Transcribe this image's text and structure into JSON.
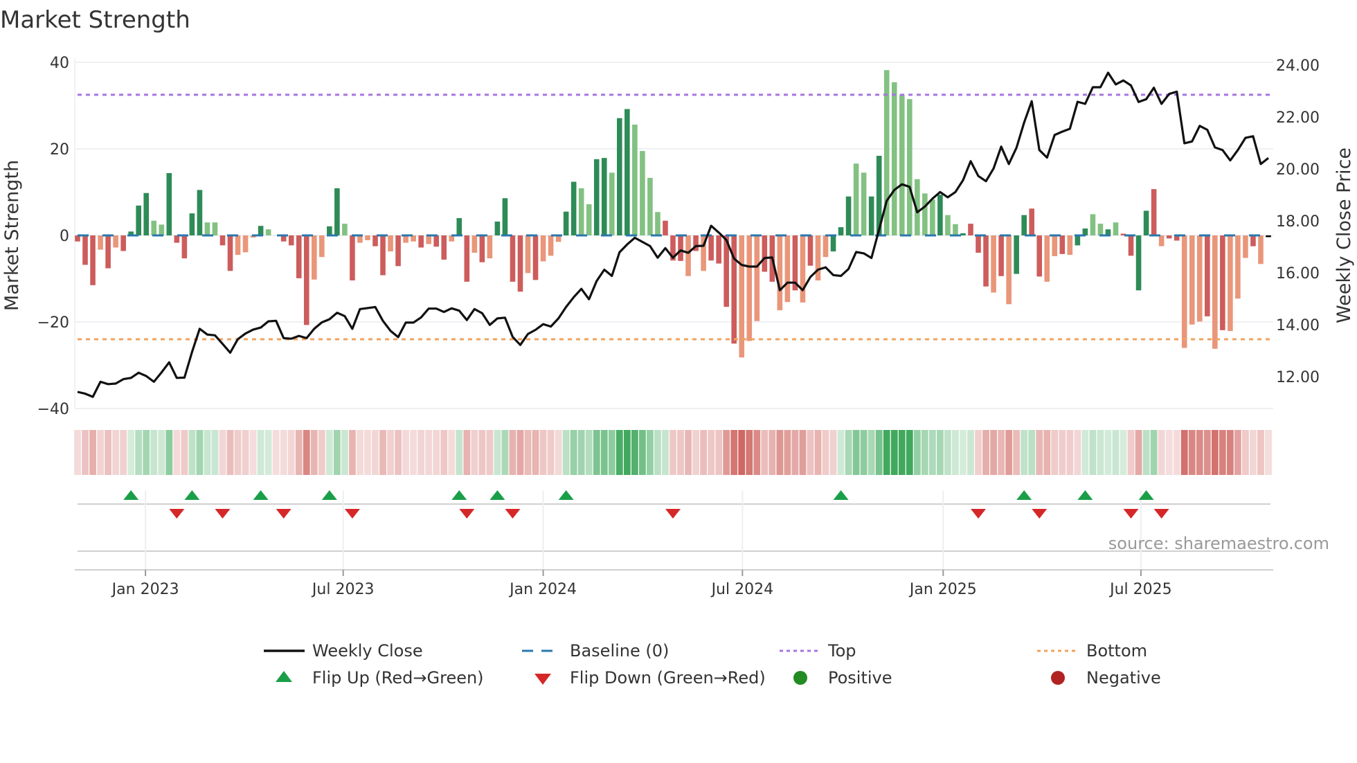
{
  "title": "Market Strength",
  "source": "source: sharemaestro.com",
  "colors": {
    "strong_positive": "#2e8b57",
    "weak_positive": "#82c182",
    "strong_negative": "#cd5c5c",
    "weak_negative": "#e9967a",
    "weekly_close": "#111111",
    "baseline": "#2a77ad",
    "top": "#a774e0",
    "bottom": "#f0a35e",
    "flip_up": "#1a9f48",
    "flip_down": "#d62728",
    "positive": "#228b22",
    "negative": "#b22222",
    "heat_green": "#2ca04c",
    "heat_red": "#c9544f"
  },
  "legend": [
    {
      "label": "Weekly Close",
      "icon": "solid-line"
    },
    {
      "label": "Baseline (0)",
      "icon": "dashed-line"
    },
    {
      "label": "Top",
      "icon": "dotted-line"
    },
    {
      "label": "Bottom",
      "icon": "dotted-line"
    },
    {
      "label": "Flip Up (Red→Green)",
      "icon": "triangle-up"
    },
    {
      "label": "Flip Down (Green→Red)",
      "icon": "triangle-down"
    },
    {
      "label": "Positive",
      "icon": "circle"
    },
    {
      "label": "Negative",
      "icon": "circle"
    }
  ],
  "chart_data": {
    "type": "bar",
    "title": "Market Strength",
    "ylabel": "Market Strength",
    "y2label": "Weekly Close Price",
    "ylim": [
      -40,
      40
    ],
    "y2lim": [
      10.77,
      24.11
    ],
    "grid": true,
    "legend_position": "bottom",
    "yticks": [
      {
        "v": 40,
        "label": "40"
      },
      {
        "v": 20,
        "label": "20"
      },
      {
        "v": 0,
        "label": "0"
      },
      {
        "v": -20,
        "label": "−20"
      },
      {
        "v": -40,
        "label": "−40"
      }
    ],
    "y2ticks": [
      {
        "v": 24,
        "label": "24.00"
      },
      {
        "v": 22,
        "label": "22.00"
      },
      {
        "v": 20,
        "label": "20.00"
      },
      {
        "v": 18,
        "label": "18.00"
      },
      {
        "v": 16,
        "label": "16.00"
      },
      {
        "v": 14,
        "label": "14.00"
      },
      {
        "v": 12,
        "label": "12.00"
      }
    ],
    "xticks": [
      {
        "week": 8.9,
        "label": "Jan 2023"
      },
      {
        "week": 34.8,
        "label": "Jul 2023"
      },
      {
        "week": 61,
        "label": "Jan 2024"
      },
      {
        "week": 87.1,
        "label": "Jul 2024"
      },
      {
        "week": 113.4,
        "label": "Jan 2025"
      },
      {
        "week": 139.3,
        "label": "Jul 2025"
      }
    ],
    "top_level": 32.5,
    "bottom_level": -24,
    "strength": [
      -1.4,
      -6.8,
      -11.5,
      -3.3,
      -7.6,
      -2.8,
      -3.6,
      0.9,
      6.9,
      9.8,
      3.4,
      2.5,
      14.4,
      -1.7,
      -5.3,
      5.1,
      10.5,
      3.0,
      3.0,
      -2.3,
      -8.2,
      -4.5,
      -3.9,
      -0.5,
      2.2,
      1.4,
      0,
      -1.4,
      -2.3,
      -9.9,
      -20.7,
      -10.2,
      -5,
      2.1,
      10.9,
      2.7,
      -10.4,
      -1.7,
      -1.1,
      -2.5,
      -9.2,
      -3.7,
      -7.1,
      -1.7,
      -1.4,
      -2.8,
      -2,
      -2.6,
      -5.6,
      -1.4,
      4,
      -10.7,
      -4,
      -6.2,
      -5.3,
      3.2,
      8.6,
      -10.7,
      -13,
      -8.7,
      -10.3,
      -6,
      -4.7,
      -1.5,
      5.5,
      12.4,
      10.9,
      7.2,
      17.6,
      17.9,
      14.5,
      27.1,
      29.2,
      25.6,
      19.5,
      13.3,
      5.4,
      3.4,
      -5.8,
      -5.9,
      -9.4,
      -3.6,
      -8.2,
      -5.8,
      -6.5,
      -16.5,
      -25,
      -28.2,
      -24.4,
      -19.8,
      -8.4,
      -10.7,
      -17.3,
      -15.4,
      -12.7,
      -15.5,
      -7,
      -10.4,
      -5,
      -3.7,
      1.9,
      9,
      16.6,
      14.5,
      9,
      18.4,
      38.2,
      35.4,
      32.5,
      31.5,
      13,
      9.7,
      8.3,
      9.4,
      4.7,
      2.6,
      0.5,
      2.7,
      -4,
      -11.8,
      -13.2,
      -9.4,
      -15.9,
      -8.9,
      4.7,
      6.2,
      -9.5,
      -10.7,
      -4.8,
      -4.3,
      -4.5,
      -2.3,
      1.6,
      4.9,
      2.7,
      1.4,
      3,
      0.4,
      -4.7,
      -12.7,
      5.7,
      10.7,
      -2.5,
      -0.7,
      -1.2,
      -26,
      -20.6,
      -19.9,
      -18.7,
      -26.2,
      -21.9,
      -22.1,
      -14.6,
      -5.2,
      -2.5,
      -6.6,
      -0.4
    ],
    "strength_class": "RRRrRrRGGGggGRRGGggRRrrrGgRRRRRrrGGgRrrRRrRrrRrRRrGRrRrGGRRrRrrrGGggGGgGGggggRRRrRrRRRRrrrRRrrRrRrrGGGggGGgggggggGggGRRRrRrGGRRrrRrGGggGgRRGGRrRRrrrRrRrrrRr",
    "weekly_close": [
      11.41,
      11.34,
      11.22,
      11.8,
      11.71,
      11.73,
      11.9,
      11.95,
      12.15,
      12.02,
      11.8,
      12.16,
      12.55,
      11.95,
      11.96,
      12.95,
      13.84,
      13.62,
      13.59,
      13.26,
      12.92,
      13.44,
      13.66,
      13.81,
      13.89,
      14.13,
      14.15,
      13.48,
      13.46,
      13.57,
      13.48,
      13.84,
      14.09,
      14.21,
      14.46,
      14.33,
      13.84,
      14.6,
      14.64,
      14.68,
      14.15,
      13.76,
      13.52,
      14.08,
      14.08,
      14.28,
      14.62,
      14.62,
      14.49,
      14.63,
      14.54,
      14.18,
      14.6,
      14.44,
      13.99,
      14.24,
      14.27,
      13.53,
      13.22,
      13.64,
      13.8,
      14.02,
      13.93,
      14.24,
      14.68,
      15.06,
      15.38,
      14.98,
      15.68,
      16.12,
      15.88,
      16.79,
      17.09,
      17.35,
      17.19,
      17.03,
      16.58,
      16.95,
      16.58,
      16.86,
      16.77,
      17.03,
      17.04,
      17.81,
      17.55,
      17.26,
      16.55,
      16.3,
      16.24,
      16.24,
      16.57,
      16.59,
      15.33,
      15.62,
      15.62,
      15.33,
      15.84,
      16.12,
      16.21,
      15.91,
      15.88,
      16.15,
      16.8,
      16.75,
      16.57,
      17.66,
      18.77,
      19.19,
      19.41,
      19.31,
      18.33,
      18.55,
      18.86,
      19.11,
      18.91,
      19.11,
      19.57,
      20.3,
      19.73,
      19.53,
      20.02,
      20.86,
      20.19,
      20.82,
      21.79,
      22.61,
      20.73,
      20.44,
      21.31,
      21.44,
      21.55,
      22.59,
      22.51,
      23.15,
      23.15,
      23.71,
      23.26,
      23.41,
      23.22,
      22.58,
      22.69,
      23.13,
      22.51,
      22.89,
      22.98,
      20.99,
      21.06,
      21.66,
      21.51,
      20.83,
      20.73,
      20.33,
      20.73,
      21.2,
      21.26,
      20.19,
      20.42
    ],
    "flip_up_weeks": [
      7,
      15,
      24,
      33,
      50,
      55,
      64,
      100,
      124,
      132,
      140
    ],
    "flip_down_weeks": [
      13,
      19,
      27,
      36,
      51,
      57,
      78,
      118,
      126,
      138,
      142
    ]
  }
}
